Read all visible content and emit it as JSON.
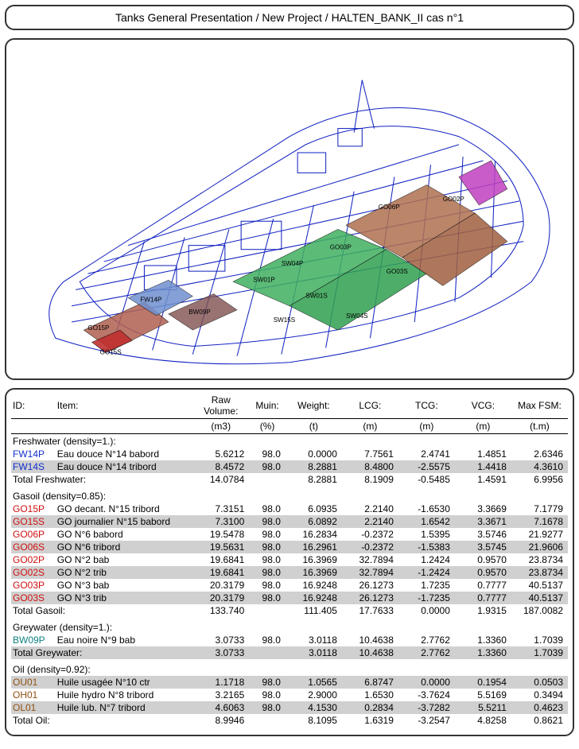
{
  "title": "Tanks General Presentation / New Project / HALTEN_BANK_II  cas n°1",
  "columns": {
    "id": "ID:",
    "item": "Item:",
    "rawvol": "Raw Volume:",
    "rawvol_u": "(m3)",
    "muin": "Muin:",
    "muin_u": "(%)",
    "weight": "Weight:",
    "weight_u": "(t)",
    "lcg": "LCG:",
    "lcg_u": "(m)",
    "tcg": "TCG:",
    "tcg_u": "(m)",
    "vcg": "VCG:",
    "vcg_u": "(m)",
    "maxfsm": "Max FSM:",
    "maxfsm_u": "(t.m)"
  },
  "groups": [
    {
      "label": "Freshwater (density=1.):",
      "color": "c-blue",
      "rows": [
        {
          "id": "FW14P",
          "item": "Eau douce N°14 babord",
          "rawvol": "5.6212",
          "muin": "98.0",
          "weight": "0.0000",
          "lcg": "7.7561",
          "tcg": "2.4741",
          "vcg": "1.4851",
          "maxfsm": "2.6346"
        },
        {
          "id": "FW14S",
          "item": "Eau douce N°14 tribord",
          "rawvol": "8.4572",
          "muin": "98.0",
          "weight": "8.2881",
          "lcg": "8.4800",
          "tcg": "-2.5575",
          "vcg": "1.4418",
          "maxfsm": "4.3610"
        }
      ],
      "total": {
        "label": "Total Freshwater:",
        "rawvol": "14.0784",
        "muin": "",
        "weight": "8.2881",
        "lcg": "8.1909",
        "tcg": "-0.5485",
        "vcg": "1.4591",
        "maxfsm": "6.9956"
      }
    },
    {
      "label": "Gasoil (density=0.85):",
      "color": "c-red",
      "rows": [
        {
          "id": "GO15P",
          "item": "GO decant. N°15 tribord",
          "rawvol": "7.3151",
          "muin": "98.0",
          "weight": "6.0935",
          "lcg": "2.2140",
          "tcg": "-1.6530",
          "vcg": "3.3669",
          "maxfsm": "7.1779"
        },
        {
          "id": "GO15S",
          "item": "GO journalier N°15 babord",
          "rawvol": "7.3100",
          "muin": "98.0",
          "weight": "6.0892",
          "lcg": "2.2140",
          "tcg": "1.6542",
          "vcg": "3.3671",
          "maxfsm": "7.1678"
        },
        {
          "id": "GO06P",
          "item": "GO N°6 babord",
          "rawvol": "19.5478",
          "muin": "98.0",
          "weight": "16.2834",
          "lcg": "-0.2372",
          "tcg": "1.5395",
          "vcg": "3.5746",
          "maxfsm": "21.9277"
        },
        {
          "id": "GO06S",
          "item": "GO N°6 tribord",
          "rawvol": "19.5631",
          "muin": "98.0",
          "weight": "16.2961",
          "lcg": "-0.2372",
          "tcg": "-1.5383",
          "vcg": "3.5745",
          "maxfsm": "21.9606"
        },
        {
          "id": "GO02P",
          "item": "GO N°2 bab",
          "rawvol": "19.6841",
          "muin": "98.0",
          "weight": "16.3969",
          "lcg": "32.7894",
          "tcg": "1.2424",
          "vcg": "0.9570",
          "maxfsm": "23.8734"
        },
        {
          "id": "GO02S",
          "item": "GO N°2 trib",
          "rawvol": "19.6841",
          "muin": "98.0",
          "weight": "16.3969",
          "lcg": "32.7894",
          "tcg": "-1.2424",
          "vcg": "0.9570",
          "maxfsm": "23.8734"
        },
        {
          "id": "GO03P",
          "item": "GO N°3 bab",
          "rawvol": "20.3179",
          "muin": "98.0",
          "weight": "16.9248",
          "lcg": "26.1273",
          "tcg": "1.7235",
          "vcg": "0.7777",
          "maxfsm": "40.5137"
        },
        {
          "id": "GO03S",
          "item": "GO N°3 trib",
          "rawvol": "20.3179",
          "muin": "98.0",
          "weight": "16.9248",
          "lcg": "26.1273",
          "tcg": "-1.7235",
          "vcg": "0.7777",
          "maxfsm": "40.5137"
        }
      ],
      "total": {
        "label": "Total Gasoil:",
        "rawvol": "133.740",
        "muin": "",
        "weight": "111.405",
        "lcg": "17.7633",
        "tcg": "0.0000",
        "vcg": "1.9315",
        "maxfsm": "187.0082"
      }
    },
    {
      "label": "Greywater (density=1.):",
      "color": "c-teal",
      "rows": [
        {
          "id": "BW09P",
          "item": "Eau noire N°9 bab",
          "rawvol": "3.0733",
          "muin": "98.0",
          "weight": "3.0118",
          "lcg": "10.4638",
          "tcg": "2.7762",
          "vcg": "1.3360",
          "maxfsm": "1.7039"
        }
      ],
      "total": {
        "label": "Total Greywater:",
        "rawvol": "3.0733",
        "muin": "",
        "weight": "3.0118",
        "lcg": "10.4638",
        "tcg": "2.7762",
        "vcg": "1.3360",
        "maxfsm": "1.7039"
      }
    },
    {
      "label": "Oil (density=0.92):",
      "color": "c-brown",
      "rows": [
        {
          "id": "OU01",
          "item": "Huile usagée N°10 ctr",
          "rawvol": "1.1718",
          "muin": "98.0",
          "weight": "1.0565",
          "lcg": "6.8747",
          "tcg": "0.0000",
          "vcg": "0.1954",
          "maxfsm": "0.0503"
        },
        {
          "id": "OH01",
          "item": "Huile  hydro N°8 tribord",
          "rawvol": "3.2165",
          "muin": "98.0",
          "weight": "2.9000",
          "lcg": "1.6530",
          "tcg": "-3.7624",
          "vcg": "5.5169",
          "maxfsm": "0.3494"
        },
        {
          "id": "OL01",
          "item": "Huile lub. N°7 tribord",
          "rawvol": "4.6063",
          "muin": "98.0",
          "weight": "4.1530",
          "lcg": "0.2834",
          "tcg": "-3.7282",
          "vcg": "5.5211",
          "maxfsm": "0.4623"
        }
      ],
      "total": {
        "label": "Total Oil:",
        "rawvol": "8.9946",
        "muin": "",
        "weight": "8.1095",
        "lcg": "1.6319",
        "tcg": "-3.2547",
        "vcg": "4.8258",
        "maxfsm": "0.8621"
      }
    }
  ],
  "viz_labels": {
    "go06p": "GO06P",
    "go03p": "GO03P",
    "go02p": "GO02P",
    "go03s": "GO03S",
    "sw04p": "SW04P",
    "sw01p": "SW01P",
    "sw01s": "SW01S",
    "sw04s": "SW04S",
    "sw15s": "SW15S",
    "fw14p": "FW14P",
    "bw09p": "BW09P",
    "go15p": "GO15P",
    "go15s": "GO15S"
  }
}
